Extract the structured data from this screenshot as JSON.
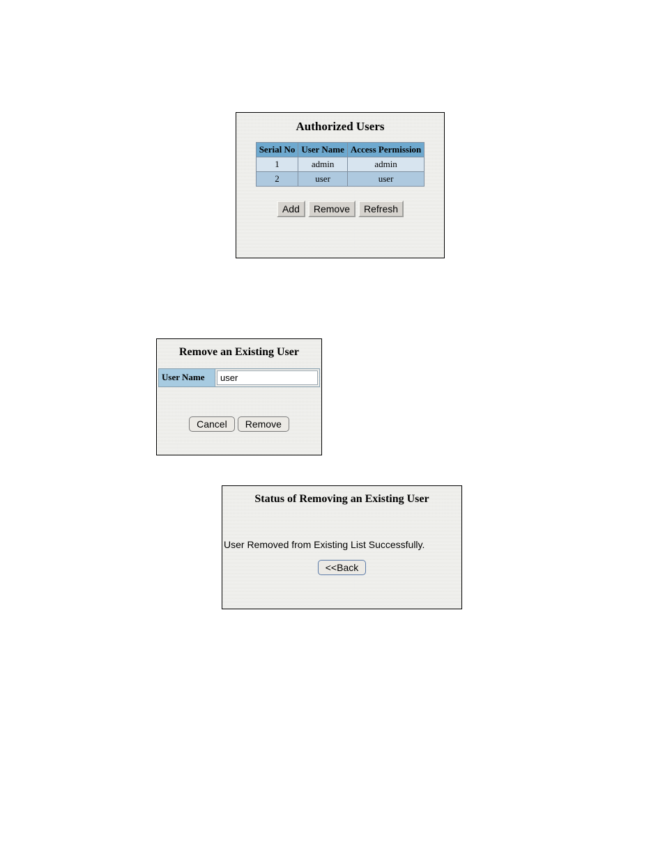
{
  "authorized": {
    "title": "Authorized Users",
    "columns": [
      "Serial No",
      "User Name",
      "Access Permission"
    ],
    "rows": [
      {
        "serial": "1",
        "username": "admin",
        "permission": "admin"
      },
      {
        "serial": "2",
        "username": "user",
        "permission": "user"
      }
    ],
    "buttons": {
      "add": "Add",
      "remove": "Remove",
      "refresh": "Refresh"
    }
  },
  "remove": {
    "title": "Remove an Existing User",
    "label": "User Name",
    "value": "user",
    "buttons": {
      "cancel": "Cancel",
      "remove": "Remove"
    }
  },
  "status": {
    "title": "Status of Removing an Existing User",
    "message": "User Removed from Existing List Successfully.",
    "back": "<<Back"
  }
}
